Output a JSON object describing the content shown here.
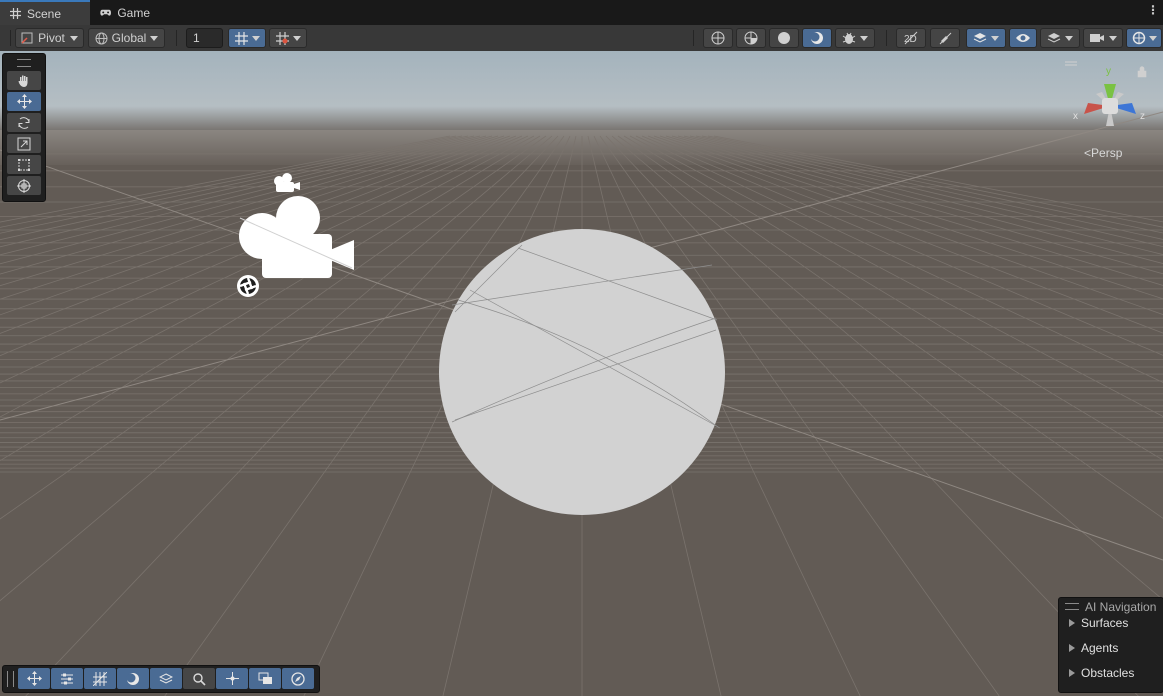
{
  "tabs": [
    {
      "label": "Scene",
      "icon": "grid-icon",
      "active": true
    },
    {
      "label": "Game",
      "icon": "gamepad-icon",
      "active": false
    }
  ],
  "toolbar": {
    "pivot_label": "Pivot",
    "global_label": "Global",
    "grid_size_value": "1"
  },
  "scene": {
    "persp_label": "Persp",
    "gizmo_axes": {
      "x": "x",
      "y": "y",
      "z": "z"
    },
    "sky_color": "#a9b4bc",
    "ground_color": "#625b55",
    "sphere_color": "#d2d2d2"
  },
  "ai_navigation": {
    "title": "AI Navigation",
    "items": [
      "Surfaces",
      "Agents",
      "Obstacles"
    ]
  },
  "colors": {
    "accent": "#4a6b94",
    "active_tab_border": "#3a79bb",
    "axis_x": "#c8534a",
    "axis_y": "#7ac243",
    "axis_z": "#3d76d6"
  }
}
